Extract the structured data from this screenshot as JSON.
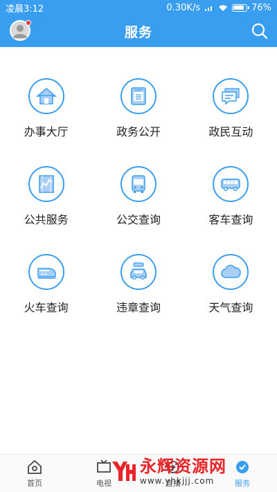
{
  "status": {
    "time": "凌晨3:12",
    "network": "0.30K/s",
    "battery": "76%"
  },
  "header": {
    "title": "服务"
  },
  "services": [
    {
      "label": "办事大厅",
      "icon": "house-icon"
    },
    {
      "label": "政务公开",
      "icon": "law-book-icon"
    },
    {
      "label": "政民互动",
      "icon": "chat-icon"
    },
    {
      "label": "公共服务",
      "icon": "chart-document-icon"
    },
    {
      "label": "公交查询",
      "icon": "bus-icon"
    },
    {
      "label": "客车查询",
      "icon": "coach-icon"
    },
    {
      "label": "火车查询",
      "icon": "train-icon"
    },
    {
      "label": "违章查询",
      "icon": "car-camera-icon"
    },
    {
      "label": "天气查询",
      "icon": "cloud-icon"
    }
  ],
  "tabs": [
    {
      "label": "首页",
      "icon": "home-icon"
    },
    {
      "label": "电视",
      "icon": "tv-icon"
    },
    {
      "label": "直播",
      "icon": "live-icon"
    },
    {
      "label": "服务",
      "icon": "service-icon"
    }
  ],
  "watermark": {
    "title": "永辉资源网",
    "url": "www.yhkjjj.com"
  },
  "colors": {
    "primary": "#3a9ef0",
    "icon_fill": "#a9cff5",
    "watermark": "#e8262a"
  }
}
